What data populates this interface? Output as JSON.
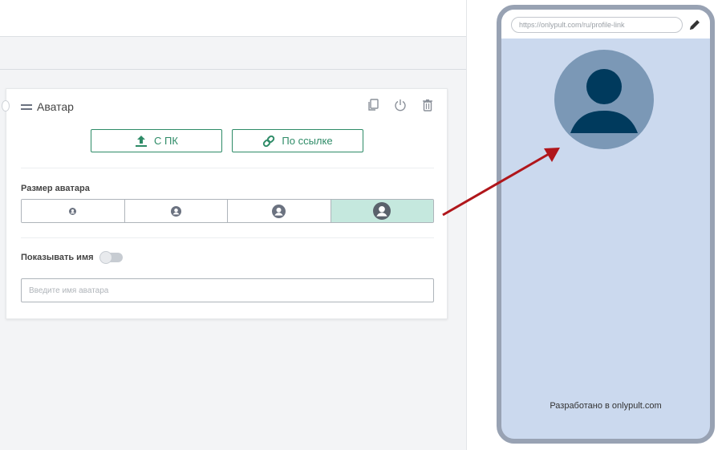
{
  "editor": {
    "block_title": "Аватар",
    "actions": [
      {
        "icon": "copy-icon"
      },
      {
        "icon": "power-icon"
      },
      {
        "icon": "trash-icon"
      }
    ],
    "upload": {
      "from_pc_label": "С ПК",
      "from_pc_icon": "upload-icon",
      "by_link_label": "По ссылке",
      "by_link_icon": "link-icon"
    },
    "size_label": "Размер аватара",
    "size_options": [
      {
        "icon": "avatar-xs-icon",
        "selected": false
      },
      {
        "icon": "avatar-s-icon",
        "selected": false
      },
      {
        "icon": "avatar-m-icon",
        "selected": false
      },
      {
        "icon": "avatar-l-icon",
        "selected": true
      }
    ],
    "show_name_label": "Показывать имя",
    "show_name_enabled": false,
    "name_placeholder": "Введите имя аватара",
    "name_value": ""
  },
  "preview": {
    "url_value": "https://onlypult.com/ru/profile-link",
    "edit_icon": "pencil-icon",
    "avatar_icon": "user-avatar-icon",
    "footer": "Разработано в onlypult.com"
  },
  "colors": {
    "accent": "#2e8b67",
    "selected_bg": "#c5e8de",
    "phone_bg": "#cbd9ee",
    "phone_frame": "#98a2b3",
    "avatar_circle": "#7b98b6",
    "avatar_figure": "#003a5d",
    "arrow": "#b0161b"
  }
}
